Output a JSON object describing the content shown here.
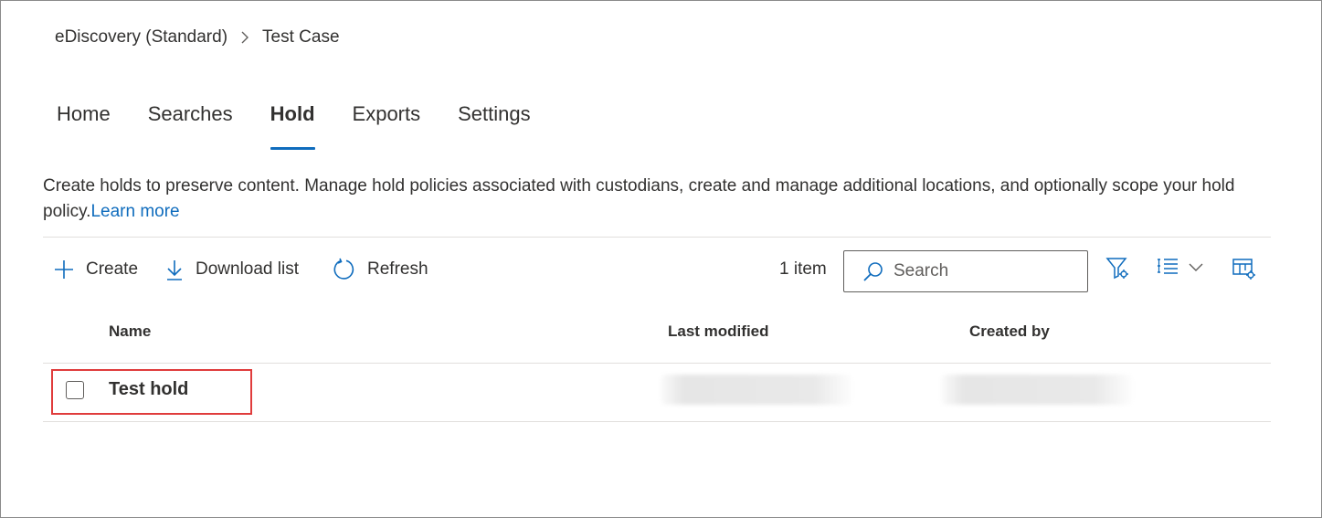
{
  "breadcrumb": {
    "parent": "eDiscovery (Standard)",
    "current": "Test Case",
    "separator_icon": "chevron-right-icon"
  },
  "tabs": [
    {
      "label": "Home",
      "active": false
    },
    {
      "label": "Searches",
      "active": false
    },
    {
      "label": "Hold",
      "active": true
    },
    {
      "label": "Exports",
      "active": false
    },
    {
      "label": "Settings",
      "active": false
    }
  ],
  "description": {
    "text": "Create holds to preserve content. Manage hold policies associated with custodians, create and manage additional locations, and optionally scope your hold policy.",
    "link": "Learn more"
  },
  "toolbar": {
    "create_label": "Create",
    "download_label": "Download list",
    "refresh_label": "Refresh",
    "item_count": "1 item",
    "search_placeholder": "Search",
    "filter_icon": "filter-settings-icon",
    "group_icon": "list-group-icon",
    "columns_icon": "table-settings-icon"
  },
  "table": {
    "columns": [
      "Name",
      "Last modified",
      "Created by"
    ],
    "rows": [
      {
        "name": "Test hold",
        "last_modified": "",
        "created_by": ""
      }
    ]
  },
  "colors": {
    "accent": "#0f6cbd",
    "highlight_border": "#e03c3c",
    "text": "#323130"
  }
}
